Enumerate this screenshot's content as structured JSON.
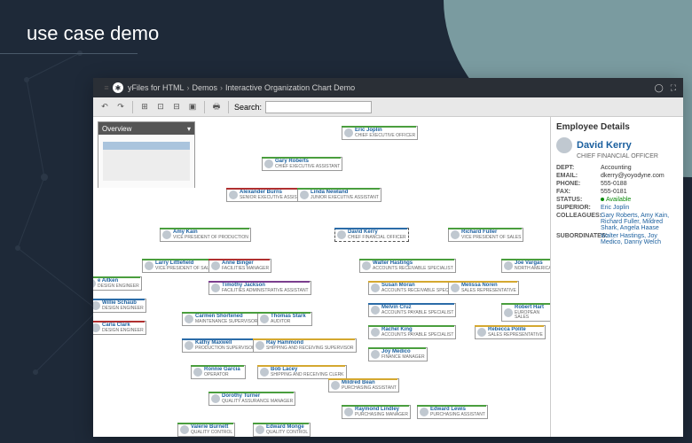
{
  "page_title": "use case demo",
  "breadcrumb": {
    "product": "yFiles for HTML",
    "section": "Demos",
    "page": "Interactive Organization Chart Demo"
  },
  "toolbar": {
    "search_label": "Search:",
    "search_placeholder": ""
  },
  "overview": {
    "title": "Overview"
  },
  "details": {
    "header": "Employee Details",
    "name": "David Kerry",
    "role": "CHIEF FINANCIAL OFFICER",
    "dept_label": "DEPT:",
    "dept": "Accounting",
    "email_label": "EMAIL:",
    "email": "dkerry@yoyodyne.com",
    "phone_label": "PHONE:",
    "phone": "555-0188",
    "fax_label": "FAX:",
    "fax": "555-0181",
    "status_label": "STATUS:",
    "status": "Available",
    "superior_label": "SUPERIOR:",
    "superior": "Eric Joplin",
    "colleagues_label": "COLLEAGUES:",
    "colleagues": "Gary Roberts, Amy Kain, Richard Fuller, Mildred Shark, Angela Haase",
    "subordinates_label": "SUBORDINATES:",
    "subordinates": "Walter Hastings, Joy Medico, Danny Welch"
  },
  "nodes": {
    "eric": {
      "name": "Eric Joplin",
      "role": "CHIEF EXECUTIVE OFFICER"
    },
    "gary": {
      "name": "Gary Roberts",
      "role": "CHIEF EXECUTIVE ASSISTANT"
    },
    "alex": {
      "name": "Alexander Burns",
      "role": "SENIOR EXECUTIVE ASSISTANT"
    },
    "linda": {
      "name": "Linda Newland",
      "role": "JUNIOR EXECUTIVE ASSISTANT"
    },
    "amy": {
      "name": "Amy Kain",
      "role": "VICE PRESIDENT OF PRODUCTION"
    },
    "david": {
      "name": "David Kerry",
      "role": "CHIEF FINANCIAL OFFICER"
    },
    "richard": {
      "name": "Richard Fuller",
      "role": "VICE PRESIDENT OF SALES"
    },
    "larry": {
      "name": "Larry Littlefield",
      "role": "VICE PRESIDENT OF SALES"
    },
    "anne": {
      "name": "Anne Binger",
      "role": "FACILITIES MANAGER"
    },
    "timothy": {
      "name": "Timothy Jackson",
      "role": "FACILITIES ADMINISTRATIVE ASSISTANT"
    },
    "walter": {
      "name": "Walter Hastings",
      "role": "ACCOUNTS RECEIVABLE SPECIALIST"
    },
    "joe": {
      "name": "Joe Vargas",
      "role": "NORTH AMERICA"
    },
    "susan": {
      "name": "Susan Moran",
      "role": "ACCOUNTS RECEIVABLE SPECIALIST"
    },
    "melissa": {
      "name": "Melissa Noren",
      "role": "SALES REPRESENTATIVE"
    },
    "melvin": {
      "name": "Melvin Cruz",
      "role": "ACCOUNTS PAYABLE SPECIALIST"
    },
    "robert": {
      "name": "Robert Hart",
      "role": "EUROPEAN SALES"
    },
    "rachel": {
      "name": "Rachel King",
      "role": "ACCOUNTS PAYABLE SPECIALIST"
    },
    "rebecca": {
      "name": "Rebecca Polite",
      "role": "SALES REPRESENTATIVE"
    },
    "joy": {
      "name": "Joy Medico",
      "role": "FINANCE MANAGER"
    },
    "aitken": {
      "name": "e Aitken",
      "role": "DESIGN ENGINEER"
    },
    "willie": {
      "name": "Willie Schaub",
      "role": "DESIGN ENGINEER"
    },
    "carla": {
      "name": "Carla Clark",
      "role": "DESIGN ENGINEER"
    },
    "carmen": {
      "name": "Carmen Shortened",
      "role": "MAINTENANCE SUPERVISOR"
    },
    "thomas": {
      "name": "Thomas Stark",
      "role": "AUDITOR"
    },
    "kathy": {
      "name": "Kathy Maxwell",
      "role": "PRODUCTION SUPERVISOR"
    },
    "ray": {
      "name": "Ray Hammond",
      "role": "SHIPPING AND RECEIVING SUPERVISOR"
    },
    "ronnie": {
      "name": "Ronnie Garcia",
      "role": "OPERATOR"
    },
    "bob": {
      "name": "Bob Lacey",
      "role": "SHIPPING AND RECEIVING CLERK"
    },
    "dorothy": {
      "name": "Dorothy Turner",
      "role": "QUALITY ASSURANCE MANAGER"
    },
    "mildred": {
      "name": "Mildred Bean",
      "role": "PURCHASING ASSISTANT"
    },
    "raymond": {
      "name": "Raymond Lindley",
      "role": "PURCHASING MANAGER"
    },
    "edward": {
      "name": "Edward Lewis",
      "role": "PURCHASING ASSISTANT"
    },
    "valerie": {
      "name": "Valerie Burnett",
      "role": "QUALITY CONTROL"
    },
    "monge": {
      "name": "Edward Monge",
      "role": "QUALITY CONTROL"
    }
  },
  "colors": {
    "green": "#4a9e3e",
    "blue": "#2b6ca8",
    "red": "#b03030",
    "yellow": "#d4a830",
    "purple": "#7a3e8e"
  }
}
